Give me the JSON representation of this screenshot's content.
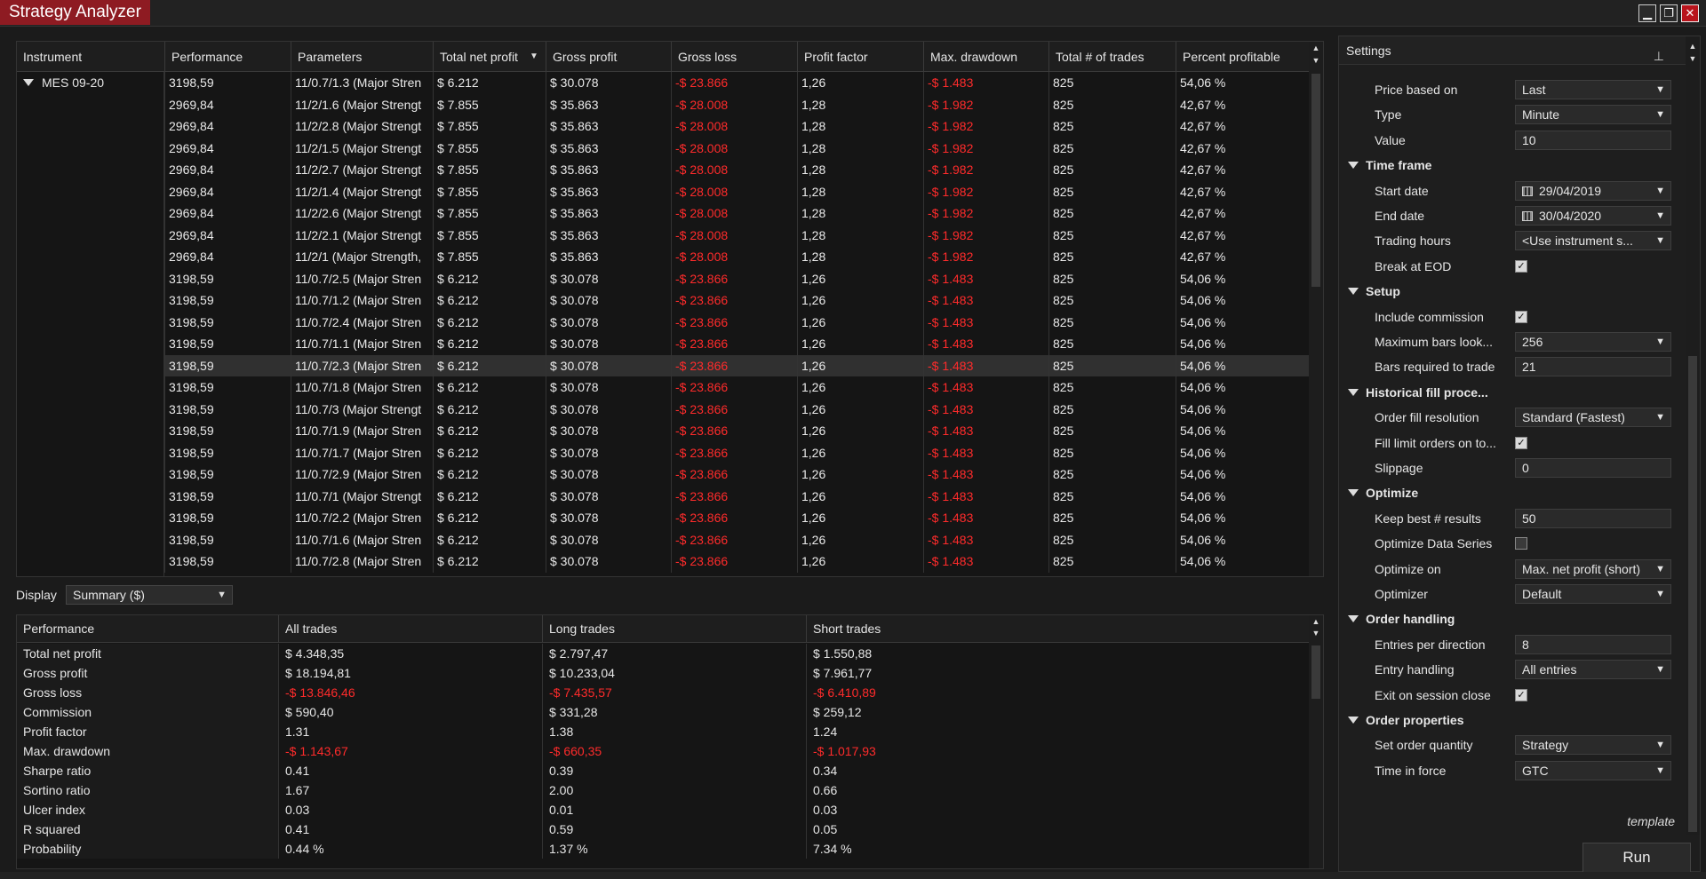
{
  "window": {
    "title": "Strategy Analyzer",
    "minimize_glyph": "▁",
    "restore_glyph": "❐",
    "close_glyph": "✕"
  },
  "results": {
    "columns": [
      "Instrument",
      "Performance",
      "Parameters",
      "Total net profit",
      "Gross profit",
      "Gross loss",
      "Profit factor",
      "Max. drawdown",
      "Total # of trades",
      "Percent profitable"
    ],
    "instrument": "MES 09-20",
    "selected_row": 13,
    "rows": [
      [
        "3198,59",
        "11/0.7/1.3 (Major Stren",
        "$ 6.212",
        "$ 30.078",
        "-$ 23.866",
        "1,26",
        "-$ 1.483",
        "825",
        "54,06 %"
      ],
      [
        "2969,84",
        "11/2/1.6 (Major Strengt",
        "$ 7.855",
        "$ 35.863",
        "-$ 28.008",
        "1,28",
        "-$ 1.982",
        "825",
        "42,67 %"
      ],
      [
        "2969,84",
        "11/2/2.8 (Major Strengt",
        "$ 7.855",
        "$ 35.863",
        "-$ 28.008",
        "1,28",
        "-$ 1.982",
        "825",
        "42,67 %"
      ],
      [
        "2969,84",
        "11/2/1.5 (Major Strengt",
        "$ 7.855",
        "$ 35.863",
        "-$ 28.008",
        "1,28",
        "-$ 1.982",
        "825",
        "42,67 %"
      ],
      [
        "2969,84",
        "11/2/2.7 (Major Strengt",
        "$ 7.855",
        "$ 35.863",
        "-$ 28.008",
        "1,28",
        "-$ 1.982",
        "825",
        "42,67 %"
      ],
      [
        "2969,84",
        "11/2/1.4 (Major Strengt",
        "$ 7.855",
        "$ 35.863",
        "-$ 28.008",
        "1,28",
        "-$ 1.982",
        "825",
        "42,67 %"
      ],
      [
        "2969,84",
        "11/2/2.6 (Major Strengt",
        "$ 7.855",
        "$ 35.863",
        "-$ 28.008",
        "1,28",
        "-$ 1.982",
        "825",
        "42,67 %"
      ],
      [
        "2969,84",
        "11/2/2.1 (Major Strengt",
        "$ 7.855",
        "$ 35.863",
        "-$ 28.008",
        "1,28",
        "-$ 1.982",
        "825",
        "42,67 %"
      ],
      [
        "2969,84",
        "11/2/1 (Major Strength,",
        "$ 7.855",
        "$ 35.863",
        "-$ 28.008",
        "1,28",
        "-$ 1.982",
        "825",
        "42,67 %"
      ],
      [
        "3198,59",
        "11/0.7/2.5 (Major Stren",
        "$ 6.212",
        "$ 30.078",
        "-$ 23.866",
        "1,26",
        "-$ 1.483",
        "825",
        "54,06 %"
      ],
      [
        "3198,59",
        "11/0.7/1.2 (Major Stren",
        "$ 6.212",
        "$ 30.078",
        "-$ 23.866",
        "1,26",
        "-$ 1.483",
        "825",
        "54,06 %"
      ],
      [
        "3198,59",
        "11/0.7/2.4 (Major Stren",
        "$ 6.212",
        "$ 30.078",
        "-$ 23.866",
        "1,26",
        "-$ 1.483",
        "825",
        "54,06 %"
      ],
      [
        "3198,59",
        "11/0.7/1.1 (Major Stren",
        "$ 6.212",
        "$ 30.078",
        "-$ 23.866",
        "1,26",
        "-$ 1.483",
        "825",
        "54,06 %"
      ],
      [
        "3198,59",
        "11/0.7/2.3 (Major Stren",
        "$ 6.212",
        "$ 30.078",
        "-$ 23.866",
        "1,26",
        "-$ 1.483",
        "825",
        "54,06 %"
      ],
      [
        "3198,59",
        "11/0.7/1.8 (Major Stren",
        "$ 6.212",
        "$ 30.078",
        "-$ 23.866",
        "1,26",
        "-$ 1.483",
        "825",
        "54,06 %"
      ],
      [
        "3198,59",
        "11/0.7/3 (Major Strengt",
        "$ 6.212",
        "$ 30.078",
        "-$ 23.866",
        "1,26",
        "-$ 1.483",
        "825",
        "54,06 %"
      ],
      [
        "3198,59",
        "11/0.7/1.9 (Major Stren",
        "$ 6.212",
        "$ 30.078",
        "-$ 23.866",
        "1,26",
        "-$ 1.483",
        "825",
        "54,06 %"
      ],
      [
        "3198,59",
        "11/0.7/1.7 (Major Stren",
        "$ 6.212",
        "$ 30.078",
        "-$ 23.866",
        "1,26",
        "-$ 1.483",
        "825",
        "54,06 %"
      ],
      [
        "3198,59",
        "11/0.7/2.9 (Major Stren",
        "$ 6.212",
        "$ 30.078",
        "-$ 23.866",
        "1,26",
        "-$ 1.483",
        "825",
        "54,06 %"
      ],
      [
        "3198,59",
        "11/0.7/1 (Major Strengt",
        "$ 6.212",
        "$ 30.078",
        "-$ 23.866",
        "1,26",
        "-$ 1.483",
        "825",
        "54,06 %"
      ],
      [
        "3198,59",
        "11/0.7/2.2 (Major Stren",
        "$ 6.212",
        "$ 30.078",
        "-$ 23.866",
        "1,26",
        "-$ 1.483",
        "825",
        "54,06 %"
      ],
      [
        "3198,59",
        "11/0.7/1.6 (Major Stren",
        "$ 6.212",
        "$ 30.078",
        "-$ 23.866",
        "1,26",
        "-$ 1.483",
        "825",
        "54,06 %"
      ],
      [
        "3198,59",
        "11/0.7/2.8 (Major Stren",
        "$ 6.212",
        "$ 30.078",
        "-$ 23.866",
        "1,26",
        "-$ 1.483",
        "825",
        "54,06 %"
      ]
    ]
  },
  "display": {
    "label": "Display",
    "selected": "Summary ($)"
  },
  "summary": {
    "columns": [
      "Performance",
      "All trades",
      "Long trades",
      "Short trades"
    ],
    "rows": [
      [
        "Total net profit",
        "$ 4.348,35",
        "$ 2.797,47",
        "$ 1.550,88"
      ],
      [
        "Gross profit",
        "$ 18.194,81",
        "$ 10.233,04",
        "$ 7.961,77"
      ],
      [
        "Gross loss",
        "-$ 13.846,46",
        "-$ 7.435,57",
        "-$ 6.410,89"
      ],
      [
        "Commission",
        "$ 590,40",
        "$ 331,28",
        "$ 259,12"
      ],
      [
        "Profit factor",
        "1.31",
        "1.38",
        "1.24"
      ],
      [
        "Max. drawdown",
        "-$ 1.143,67",
        "-$ 660,35",
        "-$ 1.017,93"
      ],
      [
        "Sharpe ratio",
        "0.41",
        "0.39",
        "0.34"
      ],
      [
        "Sortino ratio",
        "1.67",
        "2.00",
        "0.66"
      ],
      [
        "Ulcer index",
        "0.03",
        "0.01",
        "0.03"
      ],
      [
        "R squared",
        "0.41",
        "0.59",
        "0.05"
      ],
      [
        "Probability",
        "0.44 %",
        "1.37 %",
        "7.34 %"
      ]
    ]
  },
  "settings": {
    "title": "Settings",
    "pin_glyph": "⊥",
    "check_glyph": "✓",
    "items": [
      {
        "kind": "prop",
        "label": "Price based on",
        "type": "select",
        "value": "Last"
      },
      {
        "kind": "prop",
        "label": "Type",
        "type": "select",
        "value": "Minute"
      },
      {
        "kind": "prop",
        "label": "Value",
        "type": "input",
        "value": "10"
      },
      {
        "kind": "cat",
        "label": "Time frame"
      },
      {
        "kind": "prop",
        "label": "Start date",
        "type": "date",
        "value": "29/04/2019"
      },
      {
        "kind": "prop",
        "label": "End date",
        "type": "date",
        "value": "30/04/2020"
      },
      {
        "kind": "prop",
        "label": "Trading hours",
        "type": "select",
        "value": "<Use instrument s..."
      },
      {
        "kind": "prop",
        "label": "Break at EOD",
        "type": "check",
        "checked": true
      },
      {
        "kind": "cat",
        "label": "Setup"
      },
      {
        "kind": "prop",
        "label": "Include commission",
        "type": "check",
        "checked": true
      },
      {
        "kind": "prop",
        "label": "Maximum bars look...",
        "type": "select",
        "value": "256"
      },
      {
        "kind": "prop",
        "label": "Bars required to trade",
        "type": "input",
        "value": "21"
      },
      {
        "kind": "cat",
        "label": "Historical fill proce..."
      },
      {
        "kind": "prop",
        "label": "Order fill resolution",
        "type": "select",
        "value": "Standard (Fastest)"
      },
      {
        "kind": "prop",
        "label": "Fill limit orders on to...",
        "type": "check",
        "checked": true
      },
      {
        "kind": "prop",
        "label": "Slippage",
        "type": "input",
        "value": "0"
      },
      {
        "kind": "cat",
        "label": "Optimize"
      },
      {
        "kind": "prop",
        "label": "Keep best # results",
        "type": "input",
        "value": "50"
      },
      {
        "kind": "prop",
        "label": "Optimize Data Series",
        "type": "check",
        "checked": false
      },
      {
        "kind": "prop",
        "label": "Optimize on",
        "type": "select",
        "value": "Max. net profit (short)"
      },
      {
        "kind": "prop",
        "label": "Optimizer",
        "type": "select",
        "value": "Default"
      },
      {
        "kind": "cat",
        "label": "Order handling"
      },
      {
        "kind": "prop",
        "label": "Entries per direction",
        "type": "input",
        "value": "8"
      },
      {
        "kind": "prop",
        "label": "Entry handling",
        "type": "select",
        "value": "All entries"
      },
      {
        "kind": "prop",
        "label": "Exit on session close",
        "type": "check",
        "checked": true
      },
      {
        "kind": "cat",
        "label": "Order properties"
      },
      {
        "kind": "prop",
        "label": "Set order quantity",
        "type": "select",
        "value": "Strategy"
      },
      {
        "kind": "prop",
        "label": "Time in force",
        "type": "select",
        "value": "GTC"
      }
    ],
    "template_label": "template",
    "run_label": "Run"
  },
  "colors": {
    "negative": "#ff2b2b",
    "title_accent": "#8e1b22"
  }
}
